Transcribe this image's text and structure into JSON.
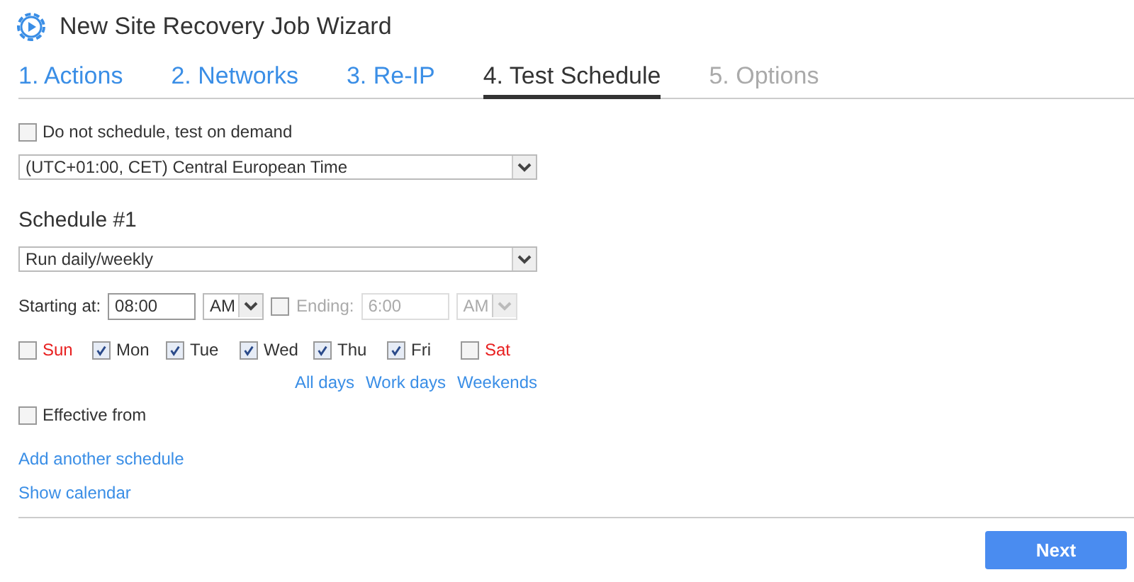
{
  "window": {
    "title": "New Site Recovery Job Wizard"
  },
  "tabs": [
    {
      "label": "1. Actions",
      "selected": false,
      "disabled": false
    },
    {
      "label": "2. Networks",
      "selected": false,
      "disabled": false
    },
    {
      "label": "3. Re-IP",
      "selected": false,
      "disabled": false
    },
    {
      "label": "4. Test Schedule",
      "selected": true,
      "disabled": false
    },
    {
      "label": "5. Options",
      "selected": false,
      "disabled": true
    }
  ],
  "on_demand": {
    "label": "Do not schedule, test on demand",
    "checked": false
  },
  "timezone": {
    "value": "(UTC+01:00, CET) Central European Time"
  },
  "schedule": {
    "heading": "Schedule #1",
    "mode": "Run daily/weekly",
    "start_label": "Starting at:",
    "start_time": "08:00",
    "start_ampm": "AM",
    "ending": {
      "checked": false,
      "label": "Ending:",
      "time": "6:00",
      "ampm": "AM",
      "disabled": true
    },
    "days": [
      {
        "label": "Sun",
        "checked": false,
        "weekend": true
      },
      {
        "label": "Mon",
        "checked": true,
        "weekend": false
      },
      {
        "label": "Tue",
        "checked": true,
        "weekend": false
      },
      {
        "label": "Wed",
        "checked": true,
        "weekend": false
      },
      {
        "label": "Thu",
        "checked": true,
        "weekend": false
      },
      {
        "label": "Fri",
        "checked": true,
        "weekend": false
      },
      {
        "label": "Sat",
        "checked": false,
        "weekend": true
      }
    ],
    "day_links": [
      "All days",
      "Work days",
      "Weekends"
    ],
    "effective_from": {
      "label": "Effective from",
      "checked": false
    }
  },
  "links": [
    "Add another schedule",
    "Show calendar"
  ],
  "buttons": [
    "Next"
  ]
}
